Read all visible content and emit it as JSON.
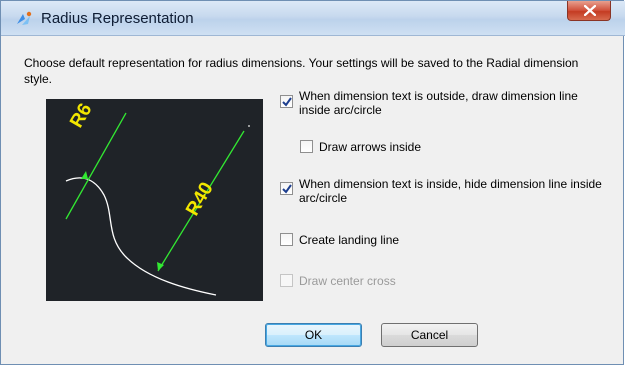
{
  "window": {
    "title": "Radius Representation",
    "description": "Choose default representation for radius dimensions. Your settings will be saved to the Radial dimension style."
  },
  "preview": {
    "label_small_radius": "R6",
    "label_large_radius": "R40",
    "colors": {
      "background": "#1f2328",
      "dimension_line": "#32e832",
      "text": "#f2e600",
      "curve": "#ffffff"
    }
  },
  "options": [
    {
      "label": "When dimension text is outside, draw dimension line inside arc/circle",
      "checked": true,
      "enabled": true
    },
    {
      "label": "Draw arrows inside",
      "checked": false,
      "enabled": true
    },
    {
      "label": "When dimension text is inside, hide dimension line inside arc/circle",
      "checked": true,
      "enabled": true
    },
    {
      "label": "Create landing line",
      "checked": false,
      "enabled": true
    },
    {
      "label": "Draw center cross",
      "checked": false,
      "enabled": false
    }
  ],
  "buttons": {
    "ok": "OK",
    "cancel": "Cancel"
  }
}
